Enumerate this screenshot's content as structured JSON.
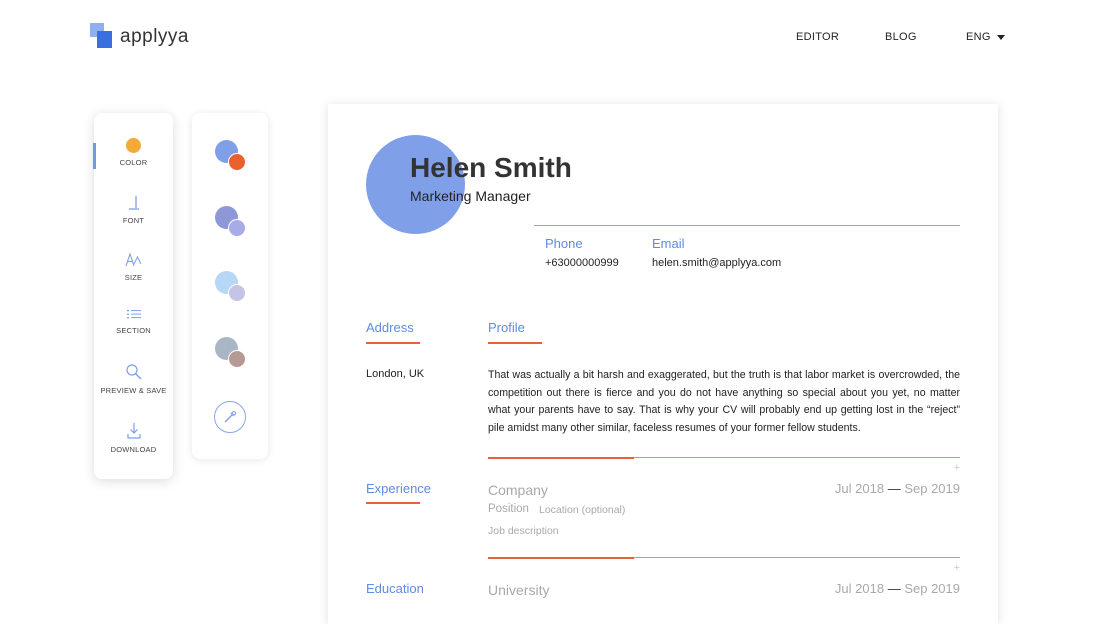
{
  "header": {
    "logo_text": "applyya",
    "nav": {
      "editor": "EDITOR",
      "blog": "BLOG",
      "lang": "ENG"
    }
  },
  "toolbar": {
    "color": "COLOR",
    "font": "FONT",
    "size": "SIZE",
    "section": "SECTION",
    "preview": "PREVIEW & SAVE",
    "download": "DOWNLOAD"
  },
  "colors": {
    "accent": "#5f8be0",
    "orange": "#e4623a",
    "swatches": [
      {
        "big": "#7f9fe8",
        "small": "#e8612f"
      },
      {
        "big": "#8e97d8",
        "small": "#a7abe6"
      },
      {
        "big": "#b7d7f6",
        "small": "#c5c3e6"
      },
      {
        "big": "#a9b6c6",
        "small": "#b49a92"
      }
    ]
  },
  "resume": {
    "name": "Helen Smith",
    "title": "Marketing Manager",
    "phone_label": "Phone",
    "phone_value": "+63000000999",
    "email_label": "Email",
    "email_value": "helen.smith@applyya.com",
    "address_label": "Address",
    "address_value": "London, UK",
    "profile_label": "Profile",
    "profile_text": "That was actually a bit harsh and exaggerated, but the truth is that labor market is overcrowded, the competition out there is fierce and you do not have anything so special about you yet, no matter what your parents have to say. That is why your CV will probably end up getting lost in the “reject” pile amidst many other similar, faceless resumes of your former fellow students.",
    "experience_label": "Experience",
    "company": "Company",
    "position": "Position",
    "location": "Location (optional)",
    "job_description": "Job description",
    "exp_start": "Jul 2018",
    "exp_dash": "—",
    "exp_end": "Sep 2019",
    "education_label": "Education",
    "university": "University",
    "edu_start": "Jul 2018",
    "edu_dash": "—",
    "edu_end": "Sep 2019",
    "plus": "+"
  }
}
